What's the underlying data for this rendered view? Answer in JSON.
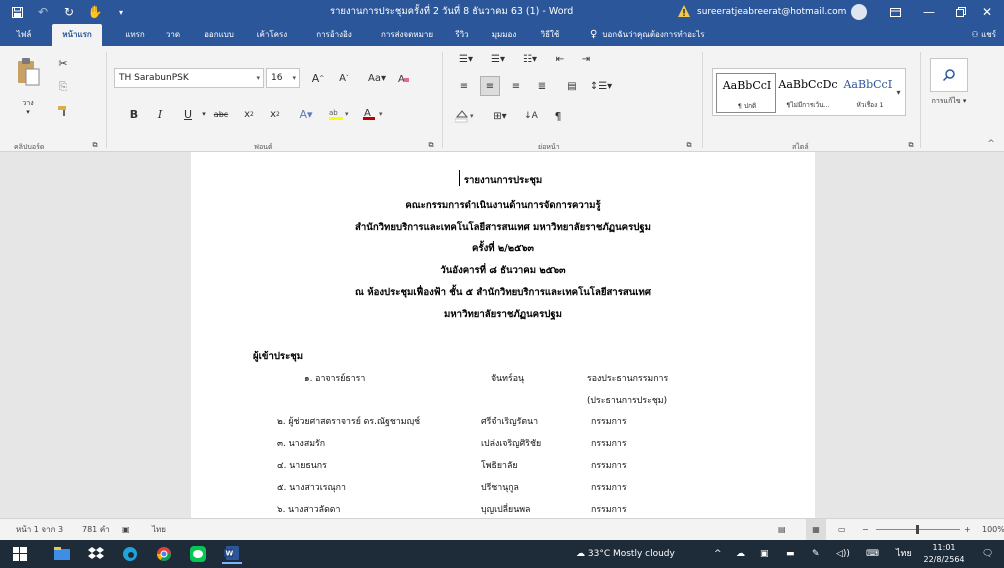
{
  "window": {
    "title": "รายงานการประชุมครั้งที่ 2 วันที่ 8 ธันวาคม 63 (1) - Word",
    "user_email": "sureeratjeabreerat@hotmail.com"
  },
  "tabs": [
    "ไฟล์",
    "หน้าแรก",
    "แทรก",
    "วาด",
    "ออกแบบ",
    "เค้าโครง",
    "การอ้างอิง",
    "การส่งจดหมาย",
    "รีวิว",
    "มุมมอง",
    "วิธีใช้"
  ],
  "tell_me": "บอกฉันว่าคุณต้องการทำอะไร",
  "share": "แชร์",
  "ribbon": {
    "paste_label": "วาง",
    "font_name": "TH SarabunPSK",
    "font_size": "16",
    "styles": [
      {
        "sample": "AaBbCcI",
        "name": "¶ ปกติ"
      },
      {
        "sample": "AaBbCcDc",
        "name": "¶ไม่มีการเว้น..."
      },
      {
        "sample": "AaBbCcD",
        "name": "หัวเรื่อง 1"
      }
    ],
    "edit_label": "การแก้ไข",
    "groups": {
      "clipboard": "คลิปบอร์ด",
      "font": "ฟอนต์",
      "paragraph": "ย่อหน้า",
      "styles": "สไตล์"
    }
  },
  "document": {
    "heading_lines": [
      "รายงานการประชุม",
      "คณะกรรมการดำเนินงานด้านการจัดการความรู้",
      "สำนักวิทยบริการและเทคโนโลยีสารสนเทศ มหาวิทยาลัยราชภัฏนครปฐม",
      "ครั้งที่ ๒/๒๕๖๓",
      "วันอังคารที่  ๘  ธันวาคม  ๒๕๖๓",
      "ณ ห้องประชุมเฟื่องฟ้า ชั้น ๕  สำนักวิทยบริการและเทคโนโลยีสารสนเทศ",
      "มหาวิทยาลัยราชภัฏนครปฐม"
    ],
    "attendees_heading": "ผู้เข้าประชุม",
    "attendees": [
      {
        "name": "๑. อาจารย์ธารา",
        "surname": "จันทร์อนุ",
        "role": "รองประธานกรรมการ"
      },
      {
        "name": "",
        "surname": "",
        "role": "(ประธานการประชุม)"
      },
      {
        "name": "๒. ผู้ช่วยศาสตราจารย์ ดร.ณัฐชามญฺช์",
        "surname": "ศรีจำเริญรัตนา",
        "role": "กรรมการ"
      },
      {
        "name": "๓. นางสมรัก",
        "surname": "เปล่งเจริญศิริชัย",
        "role": "กรรมการ"
      },
      {
        "name": "๔. นายธนกร",
        "surname": "โพธิยาลัย",
        "role": "กรรมการ"
      },
      {
        "name": "๕. นางสาวเรณุกา",
        "surname": "ปรีชานุกูล",
        "role": "กรรมการ"
      },
      {
        "name": "๖. นางสาวลัดดา",
        "surname": "บุญเปลี่ยนพล",
        "role": "กรรมการ"
      }
    ]
  },
  "status": {
    "page": "หน้า 1 จาก 3",
    "words": "781 คำ",
    "language": "ไทย",
    "zoom": "100%"
  },
  "taskbar": {
    "weather": "33°C Mostly cloudy",
    "ime": "ไทย",
    "time": "11:01",
    "date": "22/8/2564"
  },
  "colors": {
    "word_blue": "#2b579a",
    "taskbar": "#1e2b39"
  }
}
